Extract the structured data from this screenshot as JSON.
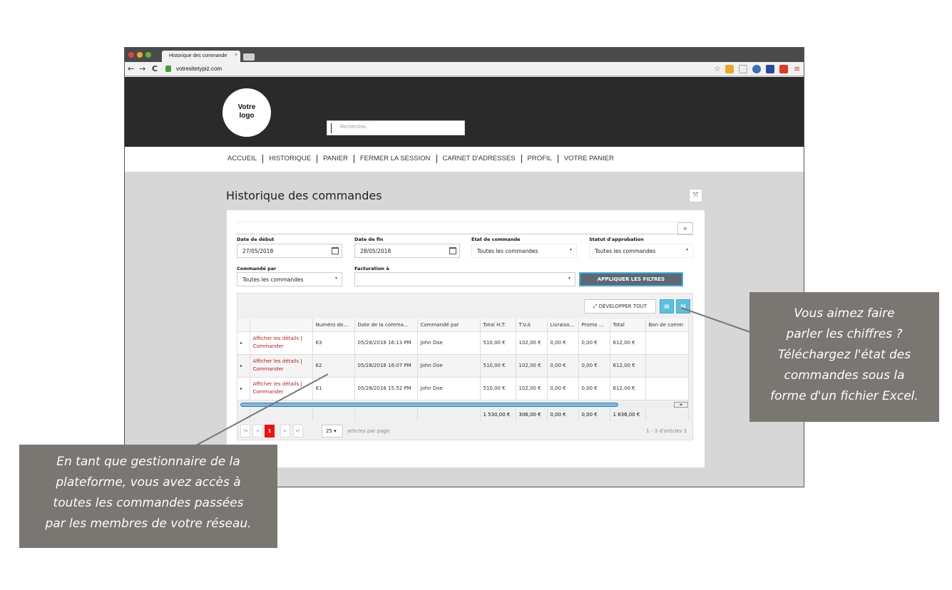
{
  "browser": {
    "tab_title": "Historique des commande",
    "tab_close": "×",
    "url": "votresitetypiz.com",
    "back": "←",
    "forward": "→",
    "reload": "C"
  },
  "site": {
    "logo_line1": "Votre",
    "logo_line2": "logo",
    "search_placeholder": "Rechercher...",
    "nav": [
      "ACCUEIL",
      "HISTORIQUE",
      "PANIER",
      "FERMER LA SESSION",
      "CARNET D'ADRESSES",
      "PROFIL",
      "VOTRE PANIER"
    ]
  },
  "page": {
    "title": "Historique des commandes",
    "expand_icon": "⤧"
  },
  "filters": {
    "start_label": "Date de début",
    "start_value": "27/05/2018",
    "end_label": "Date de fin",
    "end_value": "28/05/2018",
    "state_label": "État de commande",
    "state_value": "Toutes les commandes",
    "approval_label": "Statut d'approbation",
    "approval_value": "Toutes les commandes",
    "ordered_by_label": "Commandé par",
    "ordered_by_value": "Toutes les commandes",
    "billing_label": "Facturation à",
    "billing_value": "",
    "apply_label": "APPLIQUER LES FILTRES",
    "dropdown_arrow": "▾"
  },
  "grid": {
    "expand_all_label": "⤢ DÉVELOPPER TOUT",
    "columns": [
      "",
      "",
      "Numéro de...",
      "Date de la comma...",
      "Commandé par",
      "Total H.T:",
      "T.V.A",
      "Livraiso...",
      "Promo ...",
      "Total",
      "Bon de comm"
    ],
    "rows": [
      {
        "link1": "Afficher les détails",
        "link2": "Commander",
        "number": "63",
        "date": "05/28/2018 16:13 PM",
        "by": "John Doe",
        "ht": "510,00 €",
        "tva": "102,00 €",
        "ship": "0,00 €",
        "promo": "0,00 €",
        "total": "612,00 €",
        "po": ""
      },
      {
        "link1": "Afficher les détails",
        "link2": "Commander",
        "number": "62",
        "date": "05/28/2018 16:07 PM",
        "by": "John Doe",
        "ht": "510,00 €",
        "tva": "102,00 €",
        "ship": "0,00 €",
        "promo": "0,00 €",
        "total": "612,00 €",
        "po": ""
      },
      {
        "link1": "Afficher les détails",
        "link2": "Commander",
        "number": "61",
        "date": "05/28/2018 15:52 PM",
        "by": "John Doe",
        "ht": "510,00 €",
        "tva": "102,00 €",
        "ship": "0,00 €",
        "promo": "0,00 €",
        "total": "612,00 €",
        "po": ""
      }
    ],
    "totals": {
      "ht": "1 530,00 €",
      "tva": "306,00 €",
      "ship": "0,00 €",
      "promo": "0,00 €",
      "total": "1 836,00 €"
    },
    "pager": {
      "first": "|◂",
      "prev": "◂",
      "current": "1",
      "next": "▸",
      "last": "▸|",
      "page_size": "25 ▾",
      "per_page_label": "articles par page",
      "info": "1 - 3 d'articles 3"
    }
  },
  "callouts": {
    "right": [
      "Vous aimez faire",
      "parler les chiffres ?",
      "Téléchargez l'état des",
      "commandes sous la",
      "forme d'un fichier Excel."
    ],
    "left": [
      "En tant que gestionnaire de la",
      "plateforme, vous avez accès à",
      "toutes les commandes passées",
      "par les membres de votre réseau."
    ]
  },
  "colors": {
    "header_bg": "#2a2a2a",
    "link_red": "#b21f1f",
    "accent_blue": "#5bc0de",
    "callout_bg": "#7a7672"
  }
}
